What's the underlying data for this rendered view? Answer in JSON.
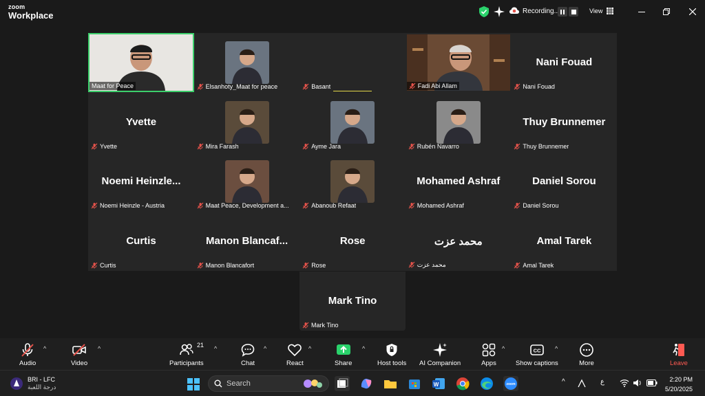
{
  "app": {
    "logo_top": "zoom",
    "logo_bottom": "Workplace",
    "recording_text": "Recording...",
    "view_label": "View"
  },
  "participants": [
    {
      "name": "Maat for Peace",
      "display": "",
      "video": true,
      "active": true
    },
    {
      "name": "Elsanhoty_Maat for peace",
      "display": "",
      "avatar": true
    },
    {
      "name": "Basant",
      "display": ""
    },
    {
      "name": "Fadi Abi Allam",
      "display": "",
      "video": true
    },
    {
      "name": "Nani Fouad",
      "display": "Nani Fouad"
    },
    {
      "name": "Yvette",
      "display": "Yvette"
    },
    {
      "name": "Mira Farash",
      "display": "",
      "avatar": true
    },
    {
      "name": "Ayme Jara",
      "display": "",
      "avatar": true
    },
    {
      "name": "Rubén Navarro",
      "display": "",
      "avatar": true
    },
    {
      "name": "Thuy Brunnemer",
      "display": "Thuy Brunnemer"
    },
    {
      "name": "Noemi Heinzle - Austria",
      "display": "Noemi  Heinzle..."
    },
    {
      "name": "Maat Peace, Development a...",
      "display": "",
      "avatar": true
    },
    {
      "name": "Abanoub Refaat",
      "display": "",
      "avatar": true
    },
    {
      "name": "Mohamed Ashraf",
      "display": "Mohamed Ashraf"
    },
    {
      "name": "Daniel Sorou",
      "display": "Daniel Sorou"
    },
    {
      "name": "Curtis",
      "display": "Curtis"
    },
    {
      "name": "Manon Blancafort",
      "display": "Manon  Blancaf..."
    },
    {
      "name": "Rose",
      "display": "Rose"
    },
    {
      "name": "محمد عزت",
      "display": "محمد عزت"
    },
    {
      "name": "Amal Tarek",
      "display": "Amal Tarek"
    }
  ],
  "extra_participant": {
    "name": "Mark Tino",
    "display": "Mark Tino"
  },
  "toolbar": {
    "audio": "Audio",
    "video": "Video",
    "participants": "Participants",
    "participants_count": "21",
    "chat": "Chat",
    "react": "React",
    "share": "Share",
    "host_tools": "Host tools",
    "ai_companion": "AI Companion",
    "apps": "Apps",
    "captions": "Show captions",
    "more": "More",
    "leave": "Leave"
  },
  "taskbar": {
    "weather_title": "BRI - LFC",
    "weather_sub": "درجة اللعبة",
    "search_placeholder": "Search",
    "tray_lang": "ع",
    "time": "2:20 PM",
    "date": "5/20/2025"
  },
  "colors": {
    "active_border": "#3ccf6b",
    "muted_red": "#e5534b",
    "leave_red": "#ff5a52",
    "share_green": "#2ad26b",
    "background": "#1a1a1a",
    "tile": "#262626"
  }
}
